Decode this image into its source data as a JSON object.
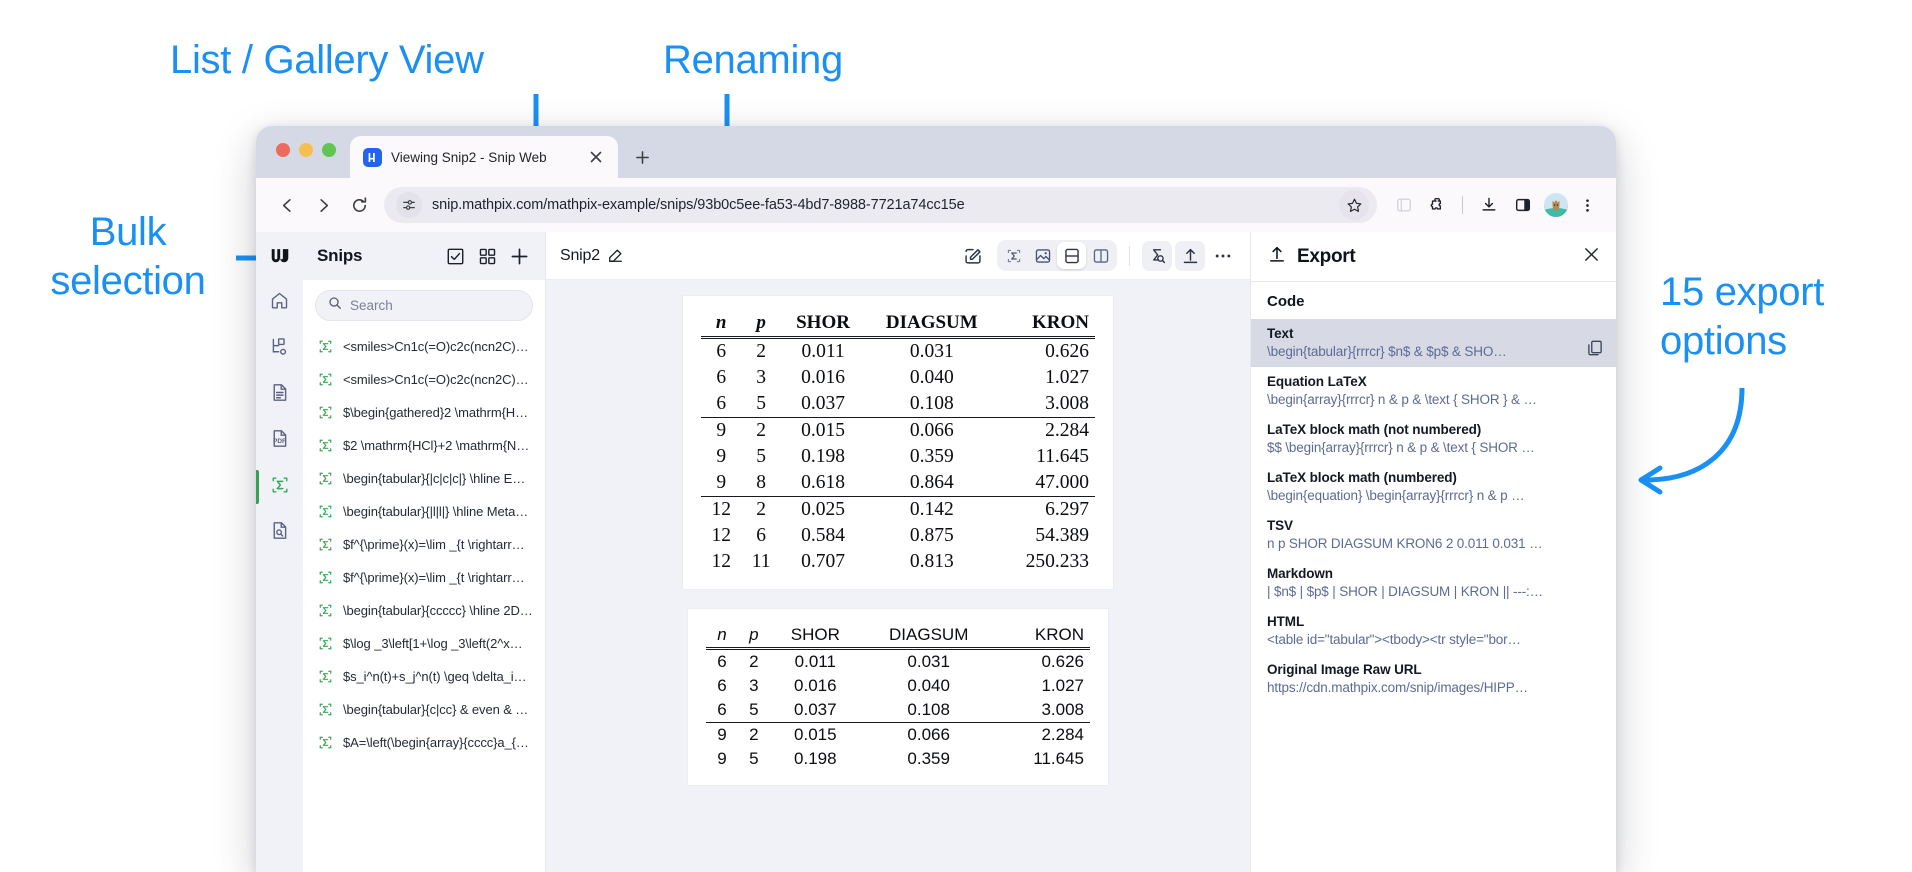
{
  "annotations": [
    {
      "id": "bulk-selection",
      "text": "Bulk\nselection"
    },
    {
      "id": "list-gallery-view",
      "text": "List / Gallery View"
    },
    {
      "id": "renaming",
      "text": "Renaming"
    },
    {
      "id": "export-options",
      "text": "15 export\noptions"
    }
  ],
  "colors": {
    "annotation": "#1a90f5",
    "accent_green": "#3aa757",
    "brand_blue": "#2264ee",
    "export_value": "#5d6b94",
    "selected_row": "#d7dae5"
  },
  "browser": {
    "tab": {
      "title": "Viewing Snip2 - Snip Web",
      "favicon_name": "mathpix-favicon",
      "close_label": "×"
    },
    "new_tab_label": "+",
    "url": "snip.mathpix.com/mathpix-example/snips/93b0c5ee-fa53-4bd7-8988-7721a74cc15e",
    "nav": {
      "back": "back-arrow-icon",
      "forward": "forward-arrow-icon",
      "reload": "reload-icon"
    },
    "toolbar_icons": [
      "bookmark-star-icon",
      "tab-search-icon",
      "extensions-puzzle-icon",
      "downloads-icon",
      "side-panel-icon",
      "profile-avatar",
      "browser-menu-icon"
    ]
  },
  "rail": {
    "logo_name": "mathpix-logo",
    "items": [
      {
        "name": "home",
        "icon": "home-icon",
        "active": false
      },
      {
        "name": "folders",
        "icon": "folder-tree-icon",
        "active": false
      },
      {
        "name": "documents",
        "icon": "document-icon",
        "active": false
      },
      {
        "name": "pdfs",
        "icon": "pdf-icon",
        "active": false
      },
      {
        "name": "snips",
        "icon": "sigma-snip-icon",
        "active": true
      },
      {
        "name": "ocr-search",
        "icon": "document-search-icon",
        "active": false
      }
    ]
  },
  "snips_panel": {
    "title": "Snips",
    "header_actions": [
      {
        "name": "bulk-select",
        "icon": "checkbox-icon"
      },
      {
        "name": "gallery-view",
        "icon": "grid-view-icon"
      },
      {
        "name": "new-snip",
        "icon": "plus-icon"
      }
    ],
    "search": {
      "placeholder": "Search",
      "value": "",
      "icon": "search-icon"
    },
    "items": [
      "<smiles>Cn1c(=O)c2c(ncn2C)n…",
      "<smiles>Cn1c(=O)c2c(ncn2C)n…",
      "$\\begin{gathered}2 \\mathrm{H…",
      "$2 \\mathrm{HCl}+2 \\mathrm{N…",
      "\\begin{tabular}{|c|c|c|} \\hline E…",
      "\\begin{tabular}{|l|l|} \\hline Meta…",
      "$f^{\\prime}(x)=\\lim _{t \\rightarr…",
      "$f^{\\prime}(x)=\\lim _{t \\rightarr…",
      "\\begin{tabular}{ccccc} \\hline 2D…",
      "$\\log _3\\left[1+\\log _3\\left(2^x…",
      "$s_i^n(t)+s_j^n(t) \\geq \\delta_i…",
      "\\begin{tabular}{c|cc} & even & …",
      "$A=\\left(\\begin{array}{cccc}a_{…"
    ]
  },
  "viewer": {
    "snip_title": "Snip2",
    "rename_icon": "rename-pencil-icon",
    "toolbar": [
      {
        "name": "edit",
        "icon": "edit-pencil-icon",
        "selected": false
      },
      {
        "name": "view-latex",
        "icon": "sigma-icon",
        "selected": false
      },
      {
        "name": "view-image",
        "icon": "image-icon",
        "selected": false
      },
      {
        "name": "split-horizontal",
        "icon": "split-horizontal-icon",
        "selected": true
      },
      {
        "name": "split-vertical",
        "icon": "split-vertical-icon",
        "selected": false
      },
      {
        "name": "search-equation",
        "icon": "sigma-search-icon",
        "selected": false
      },
      {
        "name": "export",
        "icon": "upload-icon",
        "selected": false
      },
      {
        "name": "more",
        "icon": "more-horizontal-icon",
        "selected": false
      }
    ]
  },
  "chart_data": {
    "type": "table",
    "title": "",
    "columns": [
      "n",
      "p",
      "SHOR",
      "DIAGSUM",
      "KRON"
    ],
    "rows": [
      [
        "6",
        "2",
        "0.011",
        "0.031",
        "0.626"
      ],
      [
        "6",
        "3",
        "0.016",
        "0.040",
        "1.027"
      ],
      [
        "6",
        "5",
        "0.037",
        "0.108",
        "3.008"
      ],
      [
        "9",
        "2",
        "0.015",
        "0.066",
        "2.284"
      ],
      [
        "9",
        "5",
        "0.198",
        "0.359",
        "11.645"
      ],
      [
        "9",
        "8",
        "0.618",
        "0.864",
        "47.000"
      ],
      [
        "12",
        "2",
        "0.025",
        "0.142",
        "6.297"
      ],
      [
        "12",
        "6",
        "0.584",
        "0.875",
        "54.389"
      ],
      [
        "12",
        "11",
        "0.707",
        "0.813",
        "250.233"
      ]
    ],
    "group_starts": [
      0,
      3,
      6
    ]
  },
  "export_panel": {
    "title": "Export",
    "icon": "upload-icon",
    "close_icon": "close-icon",
    "section": "Code",
    "options": [
      {
        "label": "Text",
        "value": "\\begin{tabular}{rrrcr} $n$ & $p$ & SHO…",
        "selected": true,
        "copy_icon": "copy-icon"
      },
      {
        "label": "Equation LaTeX",
        "value": "\\begin{array}{rrrcr} n & p & \\text { SHOR } & …",
        "selected": false
      },
      {
        "label": "LaTeX block math (not numbered)",
        "value": "$$ \\begin{array}{rrrcr} n & p & \\text { SHOR …",
        "selected": false
      },
      {
        "label": "LaTeX block math (numbered)",
        "value": "\\begin{equation} \\begin{array}{rrrcr} n & p …",
        "selected": false
      },
      {
        "label": "TSV",
        "value": "n p SHOR DIAGSUM KRON6 2 0.011 0.031 …",
        "selected": false
      },
      {
        "label": "Markdown",
        "value": "| $n$ | $p$ | SHOR | DIAGSUM | KRON || ---:…",
        "selected": false
      },
      {
        "label": "HTML",
        "value": "<table id=\"tabular\"><tbody><tr style=\"bor…",
        "selected": false
      },
      {
        "label": "Original Image Raw URL",
        "value": "https://cdn.mathpix.com/snip/images/HIPP…",
        "selected": false
      }
    ]
  }
}
